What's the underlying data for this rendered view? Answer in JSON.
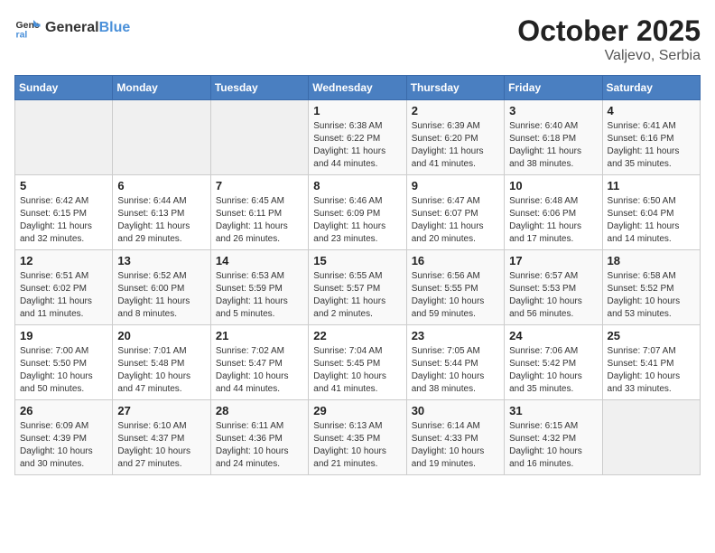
{
  "header": {
    "logo_line1": "General",
    "logo_line2": "Blue",
    "month": "October 2025",
    "location": "Valjevo, Serbia"
  },
  "days_of_week": [
    "Sunday",
    "Monday",
    "Tuesday",
    "Wednesday",
    "Thursday",
    "Friday",
    "Saturday"
  ],
  "weeks": [
    [
      {
        "day": "",
        "info": ""
      },
      {
        "day": "",
        "info": ""
      },
      {
        "day": "",
        "info": ""
      },
      {
        "day": "1",
        "info": "Sunrise: 6:38 AM\nSunset: 6:22 PM\nDaylight: 11 hours and 44 minutes."
      },
      {
        "day": "2",
        "info": "Sunrise: 6:39 AM\nSunset: 6:20 PM\nDaylight: 11 hours and 41 minutes."
      },
      {
        "day": "3",
        "info": "Sunrise: 6:40 AM\nSunset: 6:18 PM\nDaylight: 11 hours and 38 minutes."
      },
      {
        "day": "4",
        "info": "Sunrise: 6:41 AM\nSunset: 6:16 PM\nDaylight: 11 hours and 35 minutes."
      }
    ],
    [
      {
        "day": "5",
        "info": "Sunrise: 6:42 AM\nSunset: 6:15 PM\nDaylight: 11 hours and 32 minutes."
      },
      {
        "day": "6",
        "info": "Sunrise: 6:44 AM\nSunset: 6:13 PM\nDaylight: 11 hours and 29 minutes."
      },
      {
        "day": "7",
        "info": "Sunrise: 6:45 AM\nSunset: 6:11 PM\nDaylight: 11 hours and 26 minutes."
      },
      {
        "day": "8",
        "info": "Sunrise: 6:46 AM\nSunset: 6:09 PM\nDaylight: 11 hours and 23 minutes."
      },
      {
        "day": "9",
        "info": "Sunrise: 6:47 AM\nSunset: 6:07 PM\nDaylight: 11 hours and 20 minutes."
      },
      {
        "day": "10",
        "info": "Sunrise: 6:48 AM\nSunset: 6:06 PM\nDaylight: 11 hours and 17 minutes."
      },
      {
        "day": "11",
        "info": "Sunrise: 6:50 AM\nSunset: 6:04 PM\nDaylight: 11 hours and 14 minutes."
      }
    ],
    [
      {
        "day": "12",
        "info": "Sunrise: 6:51 AM\nSunset: 6:02 PM\nDaylight: 11 hours and 11 minutes."
      },
      {
        "day": "13",
        "info": "Sunrise: 6:52 AM\nSunset: 6:00 PM\nDaylight: 11 hours and 8 minutes."
      },
      {
        "day": "14",
        "info": "Sunrise: 6:53 AM\nSunset: 5:59 PM\nDaylight: 11 hours and 5 minutes."
      },
      {
        "day": "15",
        "info": "Sunrise: 6:55 AM\nSunset: 5:57 PM\nDaylight: 11 hours and 2 minutes."
      },
      {
        "day": "16",
        "info": "Sunrise: 6:56 AM\nSunset: 5:55 PM\nDaylight: 10 hours and 59 minutes."
      },
      {
        "day": "17",
        "info": "Sunrise: 6:57 AM\nSunset: 5:53 PM\nDaylight: 10 hours and 56 minutes."
      },
      {
        "day": "18",
        "info": "Sunrise: 6:58 AM\nSunset: 5:52 PM\nDaylight: 10 hours and 53 minutes."
      }
    ],
    [
      {
        "day": "19",
        "info": "Sunrise: 7:00 AM\nSunset: 5:50 PM\nDaylight: 10 hours and 50 minutes."
      },
      {
        "day": "20",
        "info": "Sunrise: 7:01 AM\nSunset: 5:48 PM\nDaylight: 10 hours and 47 minutes."
      },
      {
        "day": "21",
        "info": "Sunrise: 7:02 AM\nSunset: 5:47 PM\nDaylight: 10 hours and 44 minutes."
      },
      {
        "day": "22",
        "info": "Sunrise: 7:04 AM\nSunset: 5:45 PM\nDaylight: 10 hours and 41 minutes."
      },
      {
        "day": "23",
        "info": "Sunrise: 7:05 AM\nSunset: 5:44 PM\nDaylight: 10 hours and 38 minutes."
      },
      {
        "day": "24",
        "info": "Sunrise: 7:06 AM\nSunset: 5:42 PM\nDaylight: 10 hours and 35 minutes."
      },
      {
        "day": "25",
        "info": "Sunrise: 7:07 AM\nSunset: 5:41 PM\nDaylight: 10 hours and 33 minutes."
      }
    ],
    [
      {
        "day": "26",
        "info": "Sunrise: 6:09 AM\nSunset: 4:39 PM\nDaylight: 10 hours and 30 minutes."
      },
      {
        "day": "27",
        "info": "Sunrise: 6:10 AM\nSunset: 4:37 PM\nDaylight: 10 hours and 27 minutes."
      },
      {
        "day": "28",
        "info": "Sunrise: 6:11 AM\nSunset: 4:36 PM\nDaylight: 10 hours and 24 minutes."
      },
      {
        "day": "29",
        "info": "Sunrise: 6:13 AM\nSunset: 4:35 PM\nDaylight: 10 hours and 21 minutes."
      },
      {
        "day": "30",
        "info": "Sunrise: 6:14 AM\nSunset: 4:33 PM\nDaylight: 10 hours and 19 minutes."
      },
      {
        "day": "31",
        "info": "Sunrise: 6:15 AM\nSunset: 4:32 PM\nDaylight: 10 hours and 16 minutes."
      },
      {
        "day": "",
        "info": ""
      }
    ]
  ]
}
